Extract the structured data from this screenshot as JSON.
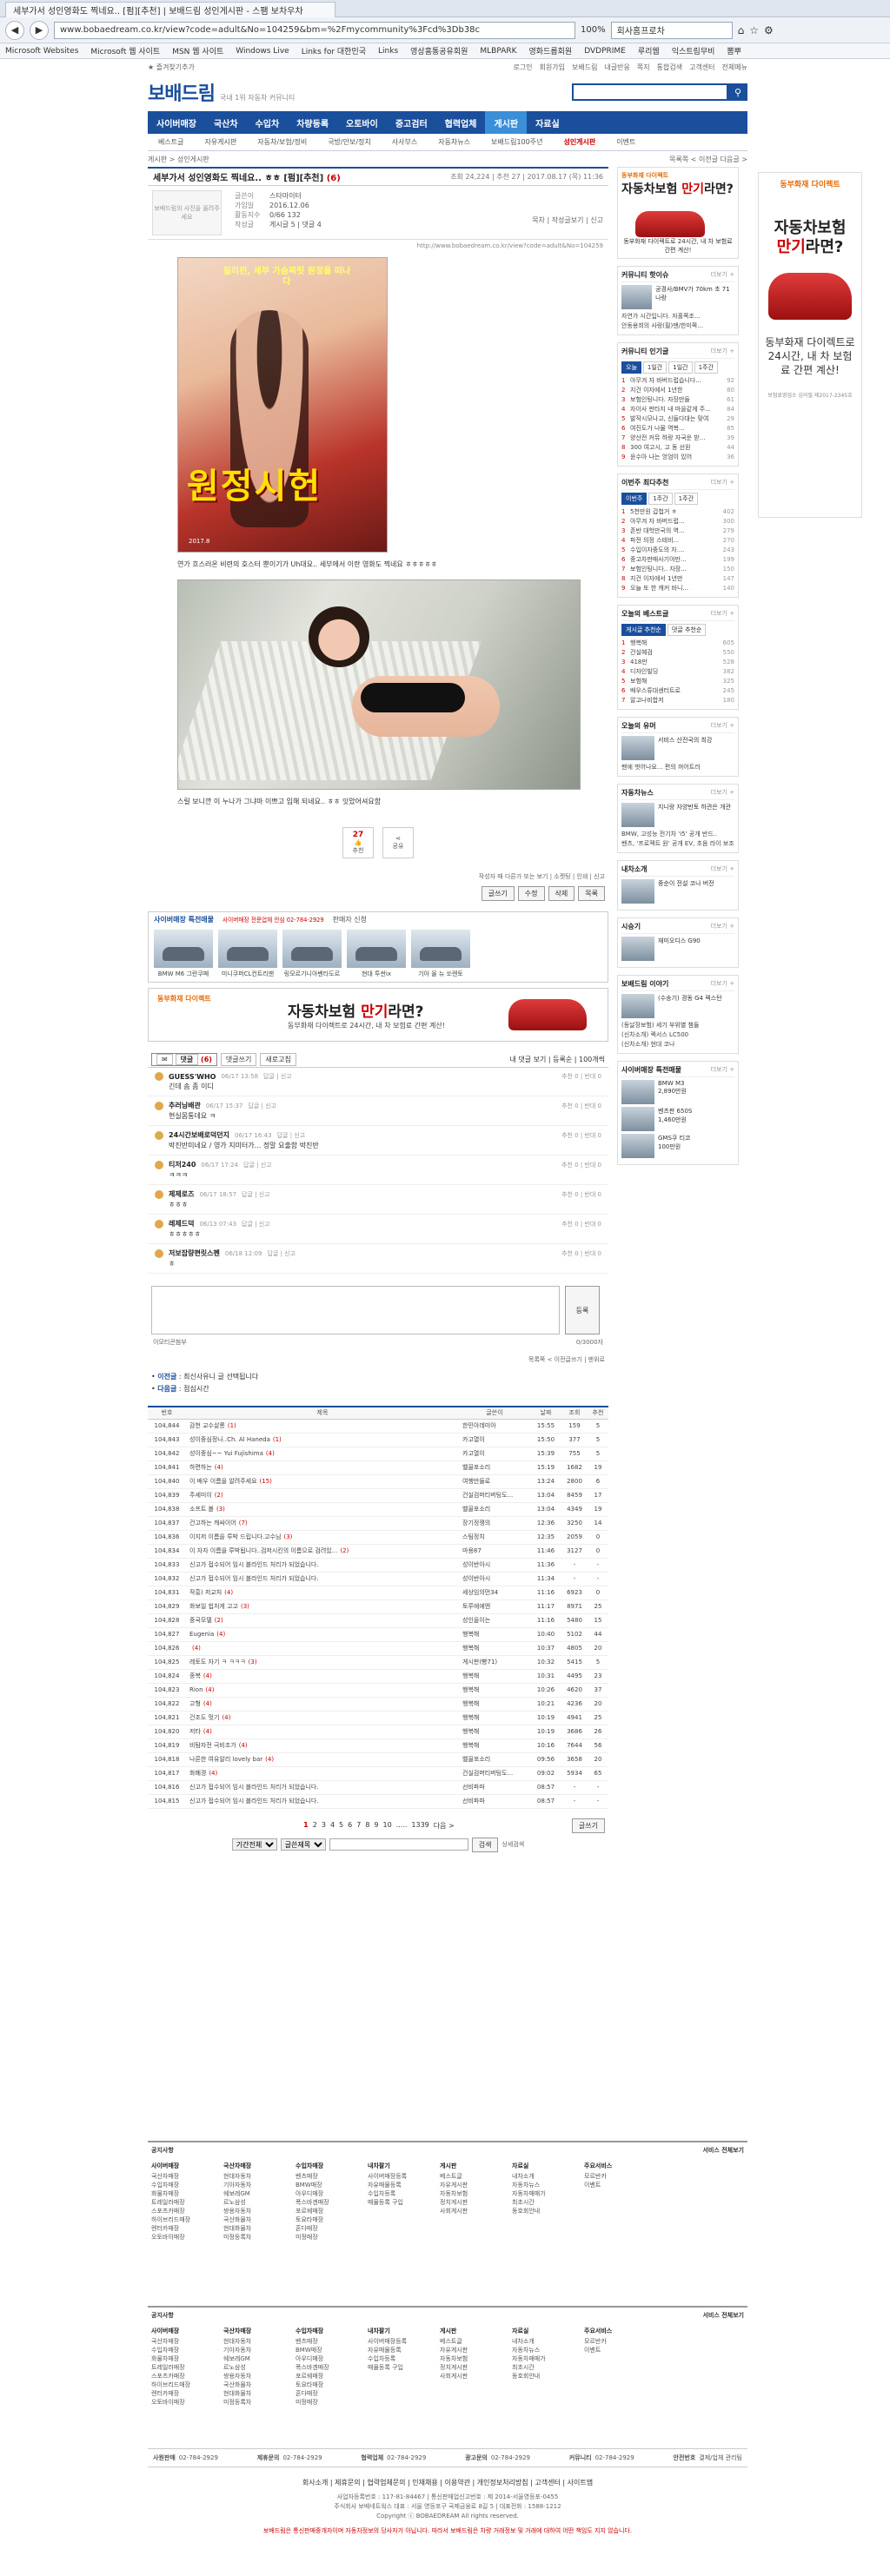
{
  "browser": {
    "tab_title": "세부가서 성인영화도 찍네요.. [펌][추천] | 보배드림 성인게시판 - 스팸 보차우차",
    "url": "www.bobaedream.co.kr/view?code=adult&No=104259&bm=%2Fmycommunity%3Fcd%3Db38c",
    "zoom": "100%",
    "search_placeholder": "회사홈프로차",
    "bookmarks": [
      "Microsoft Websites",
      "Microsoft 웹 사이트",
      "MSN 웹 사이트",
      "Windows Live",
      "Links for 대한민국",
      "Links",
      "영상홈통공유회원",
      "MLBPARK",
      "영화드롭회원",
      "DVDPRIME",
      "루리웹",
      "익스트림무비",
      "뽐뿌"
    ]
  },
  "util": {
    "left": "★ 즐겨찾기추가",
    "right": [
      "로그인",
      "회원가입",
      "보배드림",
      "내글반응",
      "쪽지",
      "통합검색",
      "고객센터",
      "전체메뉴"
    ]
  },
  "header": {
    "logo": "보배드림",
    "tagline": "국내 1위 자동차 커뮤니티",
    "search_placeholder": ""
  },
  "gnb": [
    "사이버매장",
    "국산차",
    "수입차",
    "차량등록",
    "오토바이",
    "중고검터",
    "협력업체",
    "게시판",
    "자료실"
  ],
  "subnav": [
    "베스트글",
    "자유게시판",
    "자동차/보험/정비",
    "국방/안보/정치",
    "사사부스",
    "자동차뉴스",
    "보배드림100주년",
    "성인게시판",
    "이벤트"
  ],
  "crumbs": {
    "left": "게시판 > 성인게시판",
    "right": "목록쪽 < 이전글 다음글 >"
  },
  "article": {
    "title": "세부가서 성인영화도 찍네요.. ㅎㅎ [펌][추천]",
    "comment_count": "(6)",
    "meta": "조회 24,224 | 추천 27 | 2017.08.17 (목) 11:36",
    "avatar_text": "보배드림의 사진을 올려주세요",
    "profile": [
      [
        "글쓴이",
        "스타마이터"
      ],
      [
        "가입일",
        "2016.12.06"
      ],
      [
        "활동지수",
        "0/66 132"
      ],
      [
        "작성글",
        "게시글 5 | 댓글 4"
      ]
    ],
    "profile_actions": "목차 | 작성글보기 | 신고",
    "source_url": "http://www.bobaedream.co.kr/view?code=adult&No=104259",
    "poster_tagline": "필리핀, 세부 가슴짜릿 원정을 떠나다",
    "poster_title": "원정시헌",
    "poster_credit": "2017.8",
    "caption": "연가 흐스러온 비련의 호스터 뿐이기가 Uh대요.. 세부에서 이란 영화도 찍네요 ㅎㅎㅎㅎㅎ",
    "caption2": "스릴 보니깐 이 누나가 그냐마 이쁘고 입해 되네요.. ㅎㅎ 잇았어셔요함",
    "vote_count": "27",
    "vote_label": "추천",
    "share_label": "공유",
    "foot": "작성자 때 다른가 또는 보기 | 소켓팅 | 인쇄 | 신고",
    "buttons": [
      "글쓰기",
      "수정",
      "삭제",
      "목록"
    ]
  },
  "cyber_store": {
    "title": "사이버매장 특전매물",
    "phone": "사이버매장 전문업체 안심 02-784-2929",
    "link": "판매자 신청",
    "cars": [
      "BMW M6 그란쿠페",
      "미니쿠퍼CL컨트리맨",
      "링모르기니아벤타도르",
      "현대 투싼ix",
      "기아 올 뉴 쏘렌토"
    ]
  },
  "ad": {
    "brand": "동부화재 다이렉트",
    "headline_a": "자동차보험 ",
    "headline_b": "만기",
    "headline_c": "라면?",
    "sub": "동부화재 다이렉트로 24시간, 내 차 보험료 간편 계산!"
  },
  "comments": {
    "title": "댓글",
    "count": "(6)",
    "tabs": [
      "댓글쓰기",
      "새로고침"
    ],
    "right": "내 댓글 보기 | 등록순 | 100개씩",
    "items": [
      {
        "name": "GUESS'WHO",
        "date": "06/17 13:58",
        "tools": "답글 | 신고",
        "body": "긴데 솜 좀 이디",
        "r": "추천 0 | 반대 0"
      },
      {
        "name": "추러닝배관",
        "date": "06/17 15:37",
        "tools": "답글 | 신고",
        "body": "현실몸통데요 ㅋ",
        "r": "추천 0 | 반대 0"
      },
      {
        "name": "24시간보배로덕던지",
        "date": "06/17 16:43",
        "tools": "답글 | 신고",
        "body": "박진반미네요 / 영가 지미터가... 정말 요출함 박진반",
        "r": "추천 0 | 반대 0"
      },
      {
        "name": "티저240",
        "date": "06/17 17:24",
        "tools": "답글 | 신고",
        "body": "ㅋㅋㅋ",
        "r": "추천 0 | 반대 0"
      },
      {
        "name": "제제로즈",
        "date": "06/17 18:57",
        "tools": "답글 | 신고",
        "body": "ㅎㅎㅎ",
        "r": "추천 0 | 반대 0"
      },
      {
        "name": "레제드덕",
        "date": "06/13 07:43",
        "tools": "답글 | 신고",
        "body": "ㅎㅎㅎㅎㅎ",
        "r": "추천 0 | 반대 0"
      },
      {
        "name": "저보잡량편릿스펜",
        "date": "06/18 12:09",
        "tools": "답글 | 신고",
        "body": "ㅎ",
        "r": "추천 0 | 반대 0"
      }
    ],
    "write_attach": "이모티콘첨부",
    "write_counter": "0/3000자",
    "write_submit": "등록",
    "foot": "목록쪽 < 이전글쓰기 | 맨위로"
  },
  "prevnext": {
    "prev_label": "이전글",
    "prev": "최신사유니 글 선택됩니다",
    "next_label": "다음글",
    "next": "점심시간"
  },
  "list": {
    "headers": [
      "번호",
      "제목",
      "글쓴이",
      "날짜",
      "조회",
      "추천"
    ],
    "rows": [
      [
        "104,844",
        "감천 교수살롱",
        "(1)",
        "한민아데미아",
        "15:55",
        "159",
        "5"
      ],
      [
        "104,843",
        "성이중심정나..Ch. Al Haneda",
        "(1)",
        "카고열이",
        "15:50",
        "377",
        "5"
      ],
      [
        "104,842",
        "성이중심~~ Yui Fujishima",
        "(4)",
        "카고열이",
        "15:39",
        "755",
        "5"
      ],
      [
        "104,841",
        "하면하는",
        "(4)",
        "벨꼴포소리",
        "15:19",
        "1682",
        "19"
      ],
      [
        "104,840",
        "이 배우 이름을 알려주세요",
        "(15)",
        "여행만들로",
        "13:24",
        "2800",
        "6"
      ],
      [
        "104,839",
        "주세미이",
        "(2)",
        "건실검머티버팅도...",
        "13:04",
        "8459",
        "17"
      ],
      [
        "104,838",
        "소프트 볼",
        "(3)",
        "벨꼴포소리",
        "13:04",
        "4349",
        "19"
      ],
      [
        "104,837",
        "건고하는 캐싸이어",
        "(7)",
        "장기정쟁의",
        "12:36",
        "3250",
        "14"
      ],
      [
        "104,836",
        "이지저 이름을 루박 드립니다.고수님",
        "(3)",
        "스팀정치",
        "12:35",
        "2059",
        "0"
      ],
      [
        "104,834",
        "이 자자 이름을 루박됩니다..검저시킨의 이름으로 검려있...",
        "(2)",
        "마용87",
        "11:46",
        "3127",
        "0"
      ],
      [
        "104,833",
        "신고가 접수되어 임시 블라인드 처리가 되었습니다.",
        "",
        "성이반아시",
        "11:36",
        "-",
        "-"
      ],
      [
        "104,832",
        "신고가 접수되어 임시 블라인드 처리가 되었습니다.",
        "",
        "성이반아시",
        "11:34",
        "-",
        "-"
      ],
      [
        "104,831",
        "작흥) 저교처",
        "(4)",
        "세상임의먼34",
        "11:16",
        "6923",
        "0"
      ],
      [
        "104,829",
        "화보일 힙처게 고고",
        "(3)",
        "토루에에엔",
        "11:17",
        "8971",
        "25"
      ],
      [
        "104,828",
        "중국모델",
        "(2)",
        "성인을이는",
        "11:16",
        "5480",
        "15"
      ],
      [
        "104,827",
        "Eugenia",
        "(4)",
        "행복해",
        "10:40",
        "5102",
        "44"
      ],
      [
        "104,826",
        "",
        "(4)",
        "행복해",
        "10:37",
        "4805",
        "20"
      ],
      [
        "104,825",
        "레토도 자기 ㅋ ㅋㅋㅋ",
        "(3)",
        "게시판(빵71)",
        "10:32",
        "5415",
        "5"
      ],
      [
        "104,824",
        "종복",
        "(4)",
        "행복해",
        "10:31",
        "4495",
        "23"
      ],
      [
        "104,823",
        "Rion",
        "(4)",
        "행복해",
        "10:26",
        "4620",
        "37"
      ],
      [
        "104,822",
        "고형",
        "(4)",
        "행복해",
        "10:21",
        "4236",
        "20"
      ],
      [
        "104,821",
        "건조도 멋기",
        "(4)",
        "행복해",
        "10:19",
        "4941",
        "25"
      ],
      [
        "104,820",
        "저타",
        "(4)",
        "행복해",
        "10:19",
        "3686",
        "26"
      ],
      [
        "104,819",
        "비탐자전 극비조가",
        "(4)",
        "행복해",
        "10:16",
        "7644",
        "56"
      ],
      [
        "104,818",
        "나른한 여유알리 lovely bar",
        "(4)",
        "벨꼴포소리",
        "09:56",
        "3658",
        "20"
      ],
      [
        "104,817",
        "화폐경",
        "(4)",
        "건실검머티버팅도...",
        "09:02",
        "5934",
        "65"
      ],
      [
        "104,816",
        "신고가 접수되어 임시 블라인드 처리가 되었습니다.",
        "",
        "선비파파",
        "08:57",
        "-",
        "-"
      ],
      [
        "104,815",
        "신고가 접수되어 임시 블라인드 처리가 되었습니다.",
        "",
        "선비파파",
        "08:57",
        "-",
        "-"
      ]
    ],
    "pages": [
      "1",
      "2",
      "3",
      "4",
      "5",
      "6",
      "7",
      "8",
      "9",
      "10",
      ".....",
      "1339",
      "다음 >"
    ],
    "write_btn": "글쓰기",
    "search_scope": "기간전체",
    "search_field": "글쓴제목",
    "search_btn": "검색",
    "search_link": "상세검색"
  },
  "sidebar": {
    "banner": {
      "brand": "동부화재 다이렉트",
      "h1": "자동차보험 ",
      "h2": "만기",
      "h3": "라면?",
      "sub": "동부화재 다이렉트로 24시간, 내 차 보험료 간편 계산!"
    },
    "box1": {
      "title": "커뮤니티 핫이슈",
      "more": "더보기 +",
      "thumb_text": "공경사/BMV가 70km 초 71나랑",
      "items": [
        "자연가 시간입니다. 자홀쪽조...",
        "안동용희의 사랑(필)맨/한미쪽..."
      ]
    },
    "box2": {
      "title": "커뮤니티 인기글",
      "more": "더보기 +",
      "tabs": [
        "오늘",
        "1일간",
        "1일간",
        "1주간"
      ],
      "items": [
        [
          "1",
          "아무겨 자 바버드럽습니다...",
          "92"
        ],
        [
          "2",
          "지건 이자에서 1년한",
          "80"
        ],
        [
          "3",
          "보험인팅니다. 자장만들",
          "61"
        ],
        [
          "4",
          "자이사 판타지 내 마을같게 주...",
          "84"
        ],
        [
          "5",
          "발작시모나고, 신들다대는 맞여",
          "29"
        ],
        [
          "6",
          "여진도가 나물 역복...",
          "85"
        ],
        [
          "7",
          "양산전 커뮤 하랑 자국운 받...",
          "39"
        ],
        [
          "8",
          "300 여고시, 고 동 선원",
          "44"
        ],
        [
          "9",
          "윤수아 나는 엉엄이 있어",
          "36"
        ]
      ]
    },
    "box3": {
      "title": "이번주 최다추천",
      "more": "더보기 +",
      "tabs": [
        "이번주",
        "1주간",
        "1주간"
      ],
      "items": [
        [
          "1",
          "5천만원 갑첩거 ㅎ",
          "402"
        ],
        [
          "2",
          "아무겨 자 바버드럽...",
          "300"
        ],
        [
          "3",
          "존반 대학만국의 역...",
          "279"
        ],
        [
          "4",
          "파전 의정 스테비...",
          "270"
        ],
        [
          "5",
          "수입이자중도의 자....",
          "243"
        ],
        [
          "6",
          "중고차판매사기야만...",
          "199"
        ],
        [
          "7",
          "보험인팅니다.. 자장...",
          "150"
        ],
        [
          "8",
          "지건 이자에서 1년만",
          "147"
        ],
        [
          "9",
          "오늘 또 한 캐커 바니...",
          "140"
        ]
      ]
    },
    "box4": {
      "title": "오늘의 베스트글",
      "more": "더보기 +",
      "tabs": [
        "게시글 추천순",
        "댓글 추천순"
      ],
      "items": [
        [
          "1",
          "행복해",
          "605"
        ],
        [
          "2",
          "건실혜검",
          "550"
        ],
        [
          "3",
          "418만",
          "528"
        ],
        [
          "4",
          "디자인빌딩",
          "382"
        ],
        [
          "5",
          "보험해",
          "325"
        ],
        [
          "6",
          "배우스튜대센터트로",
          "245"
        ],
        [
          "7",
          "알고나비합저",
          "180"
        ]
      ]
    },
    "box5": {
      "title": "오늘의 유머",
      "more": "더보기 +",
      "thumb_text": "서비스 산전국의 최강",
      "items": [
        "팬에 벗어나요... 편의 꺼어트러"
      ]
    },
    "box6": {
      "title": "자동차뉴스",
      "more": "더보기 +",
      "thumb_text": "지니랑 자양반토 하관은 개관",
      "items": [
        "BMW, 고성능 전기차 'i5' 공개 반드..",
        "벤츠, '프로젝트 원' 공개 EV, 초음 라이 보조장동 지게의"
      ]
    },
    "box7": {
      "title": "내차소개",
      "more": "더보기 +",
      "thumb_text": "중순이 전설 코나 버전"
    },
    "box8": {
      "title": "시승기",
      "more": "더보기 +",
      "thumb_text": "재미오디스 G90"
    },
    "box9": {
      "title": "보배드림 이야기",
      "more": "더보기 +",
      "thumb_text": "(수송기) 경동 G4 렉스턴",
      "items": [
        "(동날장보험) 세기 부위별 챔들",
        "(신차소개) 렉서스 LC500",
        "(신차소개) 현대 코나"
      ]
    },
    "box10": {
      "title": "사이버매장 특전매물",
      "more": "더보기 +",
      "cars": [
        [
          "BMW M3",
          "2,890만원"
        ],
        [
          "벤츠판 650S",
          "1,460만원"
        ],
        [
          "GMS쿠 티코",
          "100만원"
        ]
      ]
    }
  },
  "skyscraper": {
    "brand": "동부화재 다이렉트",
    "h1": "자동차보험",
    "h2": "만기",
    "h3": "라면?",
    "desc": "동부화재 다이렉트로 24시간, 내 차 보험료 간편 계산!",
    "fine": "보험료영업소 심의필 제2017-2345호"
  },
  "footer": {
    "sec_title": "공지사항",
    "sec_more": "서비스 전체보기",
    "cols": [
      {
        "h": "사이버매장",
        "items": [
          "국산차매장",
          "수입차매장",
          "화물차매장",
          "트레일러매장",
          "스포츠카매장",
          "하이브리드매장",
          "렌터카매장",
          "오토바이매장"
        ]
      },
      {
        "h": "국산차매장",
        "items": [
          "현대자동차",
          "기아자동차",
          "쉐보레GM",
          "르노삼성",
          "쌍용자동차",
          "국산화물차",
          "현대화물차",
          "미정등록차"
        ]
      },
      {
        "h": "수입차매장",
        "items": [
          "벤츠매장",
          "BMW매장",
          "아우디매장",
          "폭스바겐매장",
          "포르쉐매장",
          "토요타매장",
          "혼다매장",
          "미정매장"
        ]
      },
      {
        "h": "내차팔기",
        "items": [
          "사이버매장등록",
          "자유매물등록",
          "수입차등록",
          "매물등록 구입"
        ]
      },
      {
        "h": "게시판",
        "items": [
          "베스트글",
          "자유게시판",
          "자동차보험",
          "정치게시판",
          "사회게시판"
        ]
      },
      {
        "h": "자료실",
        "items": [
          "내차소개",
          "자동차뉴스",
          "자동차매매가",
          "최초시간",
          "동호회안내"
        ]
      },
      {
        "h": "주요서비스",
        "items": [
          "모르반카",
          "이벤트"
        ]
      }
    ],
    "dir": [
      [
        "사원판매",
        "02-784-2929"
      ],
      [
        "제휴문의",
        "02-784-2929"
      ],
      [
        "협력업체",
        "02-784-2929"
      ],
      [
        "광고문의",
        "02-784-2929"
      ],
      [
        "커뮤니티",
        "02-784-2929"
      ],
      [
        "안전번호",
        "결제/업체 관리팀"
      ]
    ],
    "links": "회사소개 | 제휴문의 | 협력업체문의 | 인재채용 | 이용약관 | 개인정보처리방침 | 고객센터 | 사이트맵",
    "copy1": "사업자등록번호 : 117-81-84467 | 통신판매업신고번호 : 제 2014-서울영등포-0455",
    "copy2": "주식회사 보배네트웍스 대표 : 서울 영등포구 국제금융로 8길 5 | 대표전화 : 1588-1212",
    "copy3": "Copyright ⓒ BOBAEDREAM All rights reserved.",
    "notice": "보배드림은 통신판매중개자이며 자동차정보의 당사자가 아닙니다. 따라서 보배드림은 차량 거래정보 및 거래에 대하여 어떤 책임도 지지 않습니다."
  }
}
